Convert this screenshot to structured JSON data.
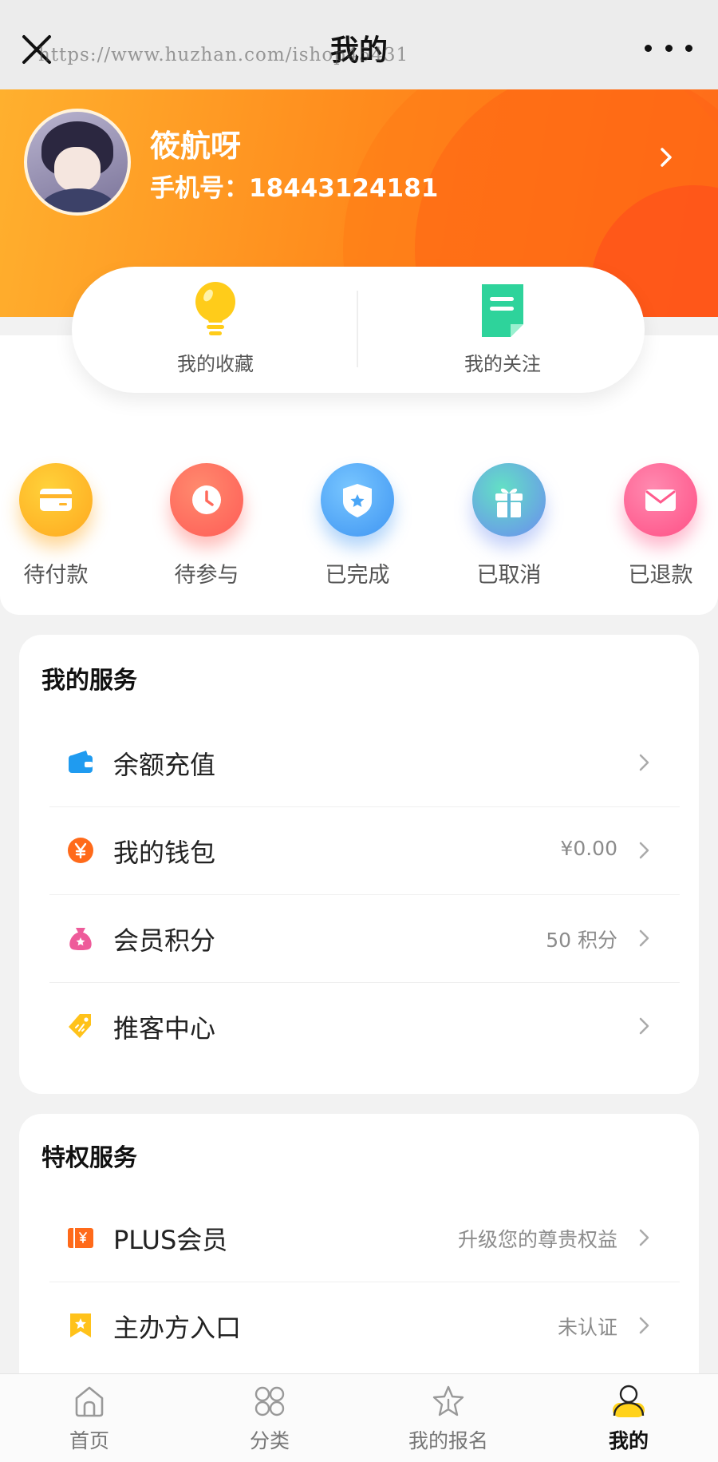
{
  "nav": {
    "title": "我的",
    "watermark": "https://www.huzhan.com/ishop45431"
  },
  "profile": {
    "name": "筱航呀",
    "phone_label": "手机号：18443124181"
  },
  "favorites": {
    "items": [
      {
        "label": "我的收藏",
        "icon": "lightbulb-icon"
      },
      {
        "label": "我的关注",
        "icon": "document-icon"
      }
    ]
  },
  "orders": {
    "items": [
      {
        "label": "待付款",
        "icon": "card-icon",
        "color": "#ffa81f"
      },
      {
        "label": "待参与",
        "icon": "clock-icon",
        "color": "#ff6a5c"
      },
      {
        "label": "已完成",
        "icon": "shield-star-icon",
        "color": "#4aa6f7"
      },
      {
        "label": "已取消",
        "icon": "gift-icon",
        "color": "#4cc9c0"
      },
      {
        "label": "已退款",
        "icon": "mail-icon",
        "color": "#ff5c8d"
      }
    ]
  },
  "my_services": {
    "title": "我的服务",
    "rows": [
      {
        "label": "余额充值",
        "value": "",
        "icon": "wallet-icon",
        "color": "#1f9bf0"
      },
      {
        "label": "我的钱包",
        "value": "¥0.00",
        "icon": "yen-icon",
        "color": "#ff6a1a"
      },
      {
        "label": "会员积分",
        "value": "50 积分",
        "icon": "moneybag-icon",
        "color": "#ee5b9a"
      },
      {
        "label": "推客中心",
        "value": "",
        "icon": "tag-icon",
        "color": "#ffc21a"
      }
    ]
  },
  "privileges": {
    "title": "特权服务",
    "rows": [
      {
        "label": "PLUS会员",
        "value": "升级您的尊贵权益",
        "icon": "vip-card-icon",
        "color": "#ff6a1a"
      },
      {
        "label": "主办方入口",
        "value": "未认证",
        "icon": "bookmark-star-icon",
        "color": "#ffc21a"
      }
    ]
  },
  "tabbar": {
    "items": [
      {
        "label": "首页",
        "icon": "home-icon"
      },
      {
        "label": "分类",
        "icon": "category-icon"
      },
      {
        "label": "我的报名",
        "icon": "star-icon"
      },
      {
        "label": "我的",
        "icon": "user-icon"
      }
    ],
    "active_index": 3
  }
}
